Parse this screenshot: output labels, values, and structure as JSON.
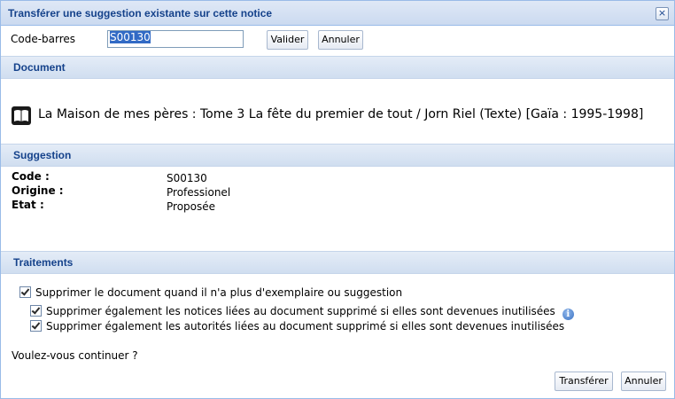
{
  "dialog": {
    "title": "Transférer une suggestion existante sur cette notice",
    "close_icon": "×"
  },
  "barcode": {
    "label": "Code-barres",
    "value": "S00130",
    "validate_label": "Valider",
    "cancel_label": "Annuler"
  },
  "document": {
    "header": "Document",
    "icon": "book-icon",
    "text": "La Maison de mes pères : Tome 3 La fête du premier de tout / Jorn Riel (Texte) [Gaïa : 1995-1998]"
  },
  "suggestion": {
    "header": "Suggestion",
    "fields": [
      {
        "label": "Code :",
        "value": "S00130"
      },
      {
        "label": "Origine :",
        "value": "Professionel"
      },
      {
        "label": "Etat :",
        "value": "Proposée"
      }
    ]
  },
  "treatments": {
    "header": "Traitements",
    "options": [
      {
        "label": "Supprimer le document quand il n'a plus d'exemplaire ou suggestion",
        "checked": true
      },
      {
        "label": "Supprimer également les notices liées au document supprimé si elles sont devenues inutilisées",
        "checked": true
      },
      {
        "label": "Supprimer également les autorités liées au document supprimé si elles sont devenues inutilisées",
        "checked": true
      }
    ],
    "info_icon": "i"
  },
  "footer": {
    "question": "Voulez-vous continuer ?",
    "transfer_label": "Transférer",
    "cancel_label": "Annuler"
  },
  "colors": {
    "title_text": "#15428b",
    "border": "#99bbe8",
    "selection": "#316ac5"
  }
}
